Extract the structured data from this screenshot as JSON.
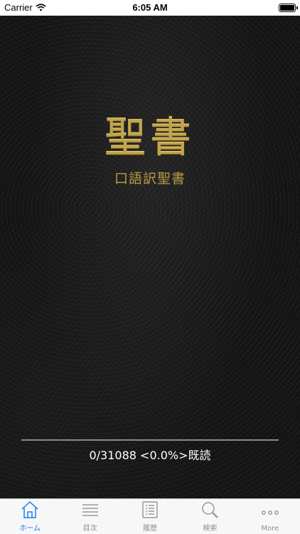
{
  "status_bar": {
    "carrier": "Carrier",
    "time": "6:05 AM"
  },
  "cover": {
    "title": "聖書",
    "subtitle": "口語訳聖書",
    "progress_fraction": 0.0,
    "progress_text": "0/31088 <0.0%>既読",
    "gold_color": "#c2a54a"
  },
  "tabs": [
    {
      "label": "ホーム",
      "icon": "home-icon",
      "active": true
    },
    {
      "label": "目次",
      "icon": "list-icon",
      "active": false
    },
    {
      "label": "履歴",
      "icon": "history-icon",
      "active": false
    },
    {
      "label": "検索",
      "icon": "search-icon",
      "active": false
    },
    {
      "label": "More",
      "icon": "more-icon",
      "active": false
    }
  ],
  "accent_color": "#1b7cf5"
}
